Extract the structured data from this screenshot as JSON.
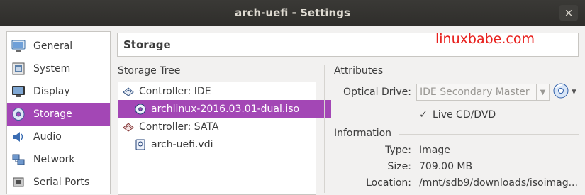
{
  "window": {
    "title": "arch-uefi - Settings",
    "close_label": "×"
  },
  "watermark": "linuxbabe.com",
  "sidebar": {
    "items": [
      {
        "label": "General",
        "icon": "general-icon"
      },
      {
        "label": "System",
        "icon": "system-icon"
      },
      {
        "label": "Display",
        "icon": "display-icon"
      },
      {
        "label": "Storage",
        "icon": "storage-icon",
        "selected": true
      },
      {
        "label": "Audio",
        "icon": "audio-icon"
      },
      {
        "label": "Network",
        "icon": "network-icon"
      },
      {
        "label": "Serial Ports",
        "icon": "serial-ports-icon"
      }
    ]
  },
  "header": {
    "title": "Storage"
  },
  "storage_tree": {
    "label": "Storage Tree",
    "rows": [
      {
        "label": "Controller: IDE",
        "icon": "ide-controller-icon"
      },
      {
        "label": "archlinux-2016.03.01-dual.iso",
        "icon": "optical-disc-icon",
        "selected": true
      },
      {
        "label": "Controller: SATA",
        "icon": "sata-controller-icon"
      },
      {
        "label": "arch-uefi.vdi",
        "icon": "hard-disk-icon"
      }
    ]
  },
  "attributes": {
    "label": "Attributes",
    "optical_drive_label": "Optical Drive:",
    "optical_drive_value": "IDE Secondary Master",
    "live_cd_label": "Live CD/DVD",
    "live_cd_checked": true
  },
  "information": {
    "label": "Information",
    "rows": [
      {
        "key": "Type:",
        "value": "Image"
      },
      {
        "key": "Size:",
        "value": "709.00 MB"
      },
      {
        "key": "Location:",
        "value": "/mnt/sdb9/downloads/isoimag..."
      }
    ]
  },
  "colors": {
    "selection": "#a347b5",
    "watermark": "#e8201d"
  }
}
